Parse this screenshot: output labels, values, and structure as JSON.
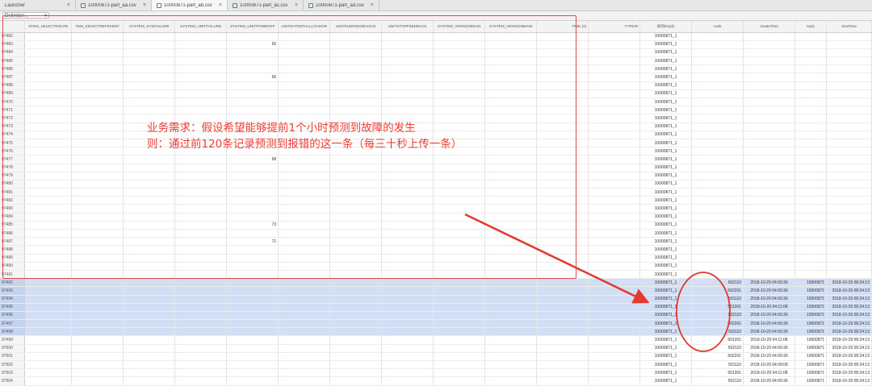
{
  "tabs": [
    {
      "label": "Launcher",
      "icon": "none"
    },
    {
      "label": "10000871-part_aa.csv",
      "icon": "sheet-icon"
    },
    {
      "label": "10000871-part_ab.csv",
      "icon": "sheet-icon",
      "active": true
    },
    {
      "label": "10000871-part_ac.csv",
      "icon": "sheet-icon"
    },
    {
      "label": "10000871-part_ad.csv",
      "icon": "sheet-icon"
    }
  ],
  "toolbar": {
    "delimiter_label": "Delimiter: ,"
  },
  "columns": [
    "",
    "STEM_SELECTROUTE",
    "TEM_SELECTREFRAENT",
    "SYSTEM_SYSFAILURE",
    "SYSTEM_UNITFAILURE",
    "SYSTEM_UNITPOWERSF",
    "UNITRATEDFULLLOADOR",
    "UNITRUNFEEDBACKSI",
    "UNITSTOPFEEDBACK",
    "SYSTEM_VERSIONMAIN",
    "SYSTEM_VERSIONMAIN",
    "TIME (2)",
    "TYPEID",
    "如何ID(pk)",
    "code",
    "createTime",
    "topic",
    "shutTime"
  ],
  "rows": [
    {
      "n": "97482",
      "e": "",
      "sel": false,
      "code": "",
      "ct": "",
      "tp": "",
      "st": ""
    },
    {
      "n": "97483",
      "e": "66",
      "sel": false,
      "code": "",
      "ct": "",
      "tp": "",
      "st": ""
    },
    {
      "n": "97484",
      "e": "",
      "sel": false,
      "code": "",
      "ct": "",
      "tp": "",
      "st": ""
    },
    {
      "n": "97485",
      "e": "",
      "sel": false,
      "code": "",
      "ct": "",
      "tp": "",
      "st": ""
    },
    {
      "n": "97486",
      "e": "",
      "sel": false,
      "code": "",
      "ct": "",
      "tp": "",
      "st": ""
    },
    {
      "n": "97487",
      "e": "66",
      "sel": false,
      "code": "",
      "ct": "",
      "tp": "",
      "st": ""
    },
    {
      "n": "97488",
      "e": "",
      "sel": false,
      "code": "",
      "ct": "",
      "tp": "",
      "st": ""
    },
    {
      "n": "97489",
      "e": "",
      "sel": false,
      "code": "",
      "ct": "",
      "tp": "",
      "st": ""
    },
    {
      "n": "97470",
      "e": "",
      "sel": false,
      "code": "",
      "ct": "",
      "tp": "",
      "st": ""
    },
    {
      "n": "97471",
      "e": "",
      "sel": false,
      "code": "",
      "ct": "",
      "tp": "",
      "st": ""
    },
    {
      "n": "97472",
      "e": "",
      "sel": false,
      "code": "",
      "ct": "",
      "tp": "",
      "st": ""
    },
    {
      "n": "97473",
      "e": "",
      "sel": false,
      "code": "",
      "ct": "",
      "tp": "",
      "st": ""
    },
    {
      "n": "97474",
      "e": "",
      "sel": false,
      "code": "",
      "ct": "",
      "tp": "",
      "st": ""
    },
    {
      "n": "97475",
      "e": "",
      "sel": false,
      "code": "",
      "ct": "",
      "tp": "",
      "st": ""
    },
    {
      "n": "97476",
      "e": "",
      "sel": false,
      "code": "",
      "ct": "",
      "tp": "",
      "st": ""
    },
    {
      "n": "97477",
      "e": "68",
      "sel": false,
      "code": "",
      "ct": "",
      "tp": "",
      "st": ""
    },
    {
      "n": "97478",
      "e": "",
      "sel": false,
      "code": "",
      "ct": "",
      "tp": "",
      "st": ""
    },
    {
      "n": "97479",
      "e": "",
      "sel": false,
      "code": "",
      "ct": "",
      "tp": "",
      "st": ""
    },
    {
      "n": "97480",
      "e": "",
      "sel": false,
      "code": "",
      "ct": "",
      "tp": "",
      "st": ""
    },
    {
      "n": "97481",
      "e": "",
      "sel": false,
      "code": "",
      "ct": "",
      "tp": "",
      "st": ""
    },
    {
      "n": "97482",
      "e": "",
      "sel": false,
      "code": "",
      "ct": "",
      "tp": "",
      "st": ""
    },
    {
      "n": "97483",
      "e": "",
      "sel": false,
      "code": "",
      "ct": "",
      "tp": "",
      "st": ""
    },
    {
      "n": "97484",
      "e": "",
      "sel": false,
      "code": "",
      "ct": "",
      "tp": "",
      "st": ""
    },
    {
      "n": "97485",
      "e": "73",
      "sel": false,
      "code": "",
      "ct": "",
      "tp": "",
      "st": ""
    },
    {
      "n": "97486",
      "e": "",
      "sel": false,
      "code": "",
      "ct": "",
      "tp": "",
      "st": ""
    },
    {
      "n": "97487",
      "e": "71",
      "sel": false,
      "code": "",
      "ct": "",
      "tp": "",
      "st": ""
    },
    {
      "n": "97488",
      "e": "",
      "sel": false,
      "code": "",
      "ct": "",
      "tp": "",
      "st": ""
    },
    {
      "n": "97489",
      "e": "",
      "sel": false,
      "code": "",
      "ct": "",
      "tp": "",
      "st": ""
    },
    {
      "n": "97490",
      "e": "",
      "sel": false,
      "code": "",
      "ct": "",
      "tp": "",
      "st": ""
    },
    {
      "n": "97491",
      "e": "",
      "sel": false,
      "code": "",
      "ct": "",
      "tp": "",
      "st": ""
    },
    {
      "n": "97492",
      "e": "",
      "sel": true,
      "code": "502110",
      "ct": "2018-10-29 04:00:36",
      "tp": "10000871",
      "st": "2018-10-29 08:24:13"
    },
    {
      "n": "97493",
      "e": "",
      "sel": true,
      "code": "502201",
      "ct": "2018-10-29 04:00:36",
      "tp": "10000871",
      "st": "2018-10-29 08:24:13"
    },
    {
      "n": "97494",
      "e": "",
      "sel": true,
      "code": "501110",
      "ct": "2018-10-29 04:00:36",
      "tp": "10000871",
      "st": "2018-10-29 08:24:13"
    },
    {
      "n": "97495",
      "e": "",
      "sel": true,
      "code": "501301",
      "ct": "2018-10-29 04:11:08",
      "tp": "10000871",
      "st": "2018-10-29 08:24:13"
    },
    {
      "n": "97496",
      "e": "",
      "sel": true,
      "code": "502110",
      "ct": "2018-10-29 04:00:36",
      "tp": "10000871",
      "st": "2018-10-29 08:24:13"
    },
    {
      "n": "97497",
      "e": "",
      "sel": true,
      "code": "502201",
      "ct": "2018-10-29 04:00:36",
      "tp": "10000871",
      "st": "2018-10-29 08:24:13"
    },
    {
      "n": "97498",
      "e": "",
      "sel": true,
      "code": "501110",
      "ct": "2018-10-29 04:00:36",
      "tp": "10000871",
      "st": "2018-10-29 08:24:13"
    },
    {
      "n": "97499",
      "e": "",
      "sel": false,
      "code": "501301",
      "ct": "2018-10-29 04:11:08",
      "tp": "10000871",
      "st": "2018-10-29 08:24:13"
    },
    {
      "n": "97500",
      "e": "",
      "sel": false,
      "code": "502110",
      "ct": "2018-10-29 04:00:36",
      "tp": "10000871",
      "st": "2018-10-29 08:24:13"
    },
    {
      "n": "97501",
      "e": "",
      "sel": false,
      "code": "502201",
      "ct": "2018-10-29 04:00:36",
      "tp": "10000871",
      "st": "2018-10-29 08:24:13"
    },
    {
      "n": "97502",
      "e": "",
      "sel": false,
      "code": "501110",
      "ct": "2018-10-29 04:09:08",
      "tp": "10000871",
      "st": "2018-10-29 08:24:13"
    },
    {
      "n": "97503",
      "e": "",
      "sel": false,
      "code": "501301",
      "ct": "2018-10-29 04:11:08",
      "tp": "10000871",
      "st": "2018-10-29 08:24:13"
    },
    {
      "n": "97504",
      "e": "",
      "sel": false,
      "code": "502110",
      "ct": "2018-10-29 04:00:36",
      "tp": "10000871",
      "st": "2018-10-29 08:24:13"
    }
  ],
  "id_value": "10000871_1",
  "annotation": {
    "line1": "业务需求：假设希望能够提前1个小时预测到故障的发生",
    "line2": "则：通过前120条记录预测到报错的这一条（每三十秒上传一条）",
    "color": "#ee3b32"
  }
}
